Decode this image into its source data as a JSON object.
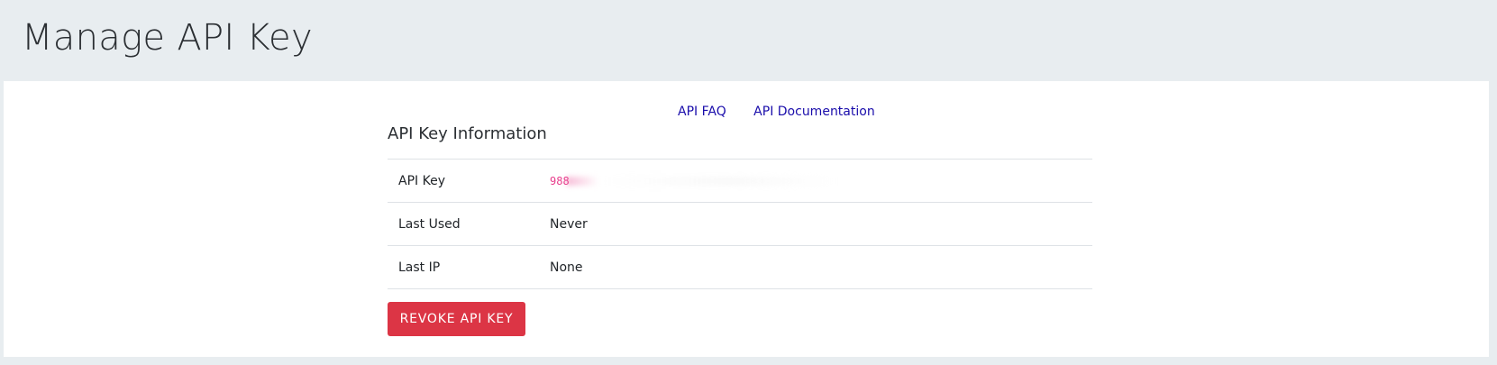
{
  "page": {
    "title": "Manage API Key"
  },
  "links": {
    "faq": "API FAQ",
    "documentation": "API Documentation"
  },
  "section": {
    "title": "API Key Information"
  },
  "info_rows": [
    {
      "label": "API Key",
      "value": "988"
    },
    {
      "label": "Last Used",
      "value": "Never"
    },
    {
      "label": "Last IP",
      "value": "None"
    }
  ],
  "actions": {
    "revoke_label": "REVOKE API KEY"
  },
  "colors": {
    "header_bg": "#e8edf0",
    "panel_bg": "#ffffff",
    "link": "#1a0dab",
    "key_text": "#e83e8c",
    "danger": "#dc3545"
  }
}
